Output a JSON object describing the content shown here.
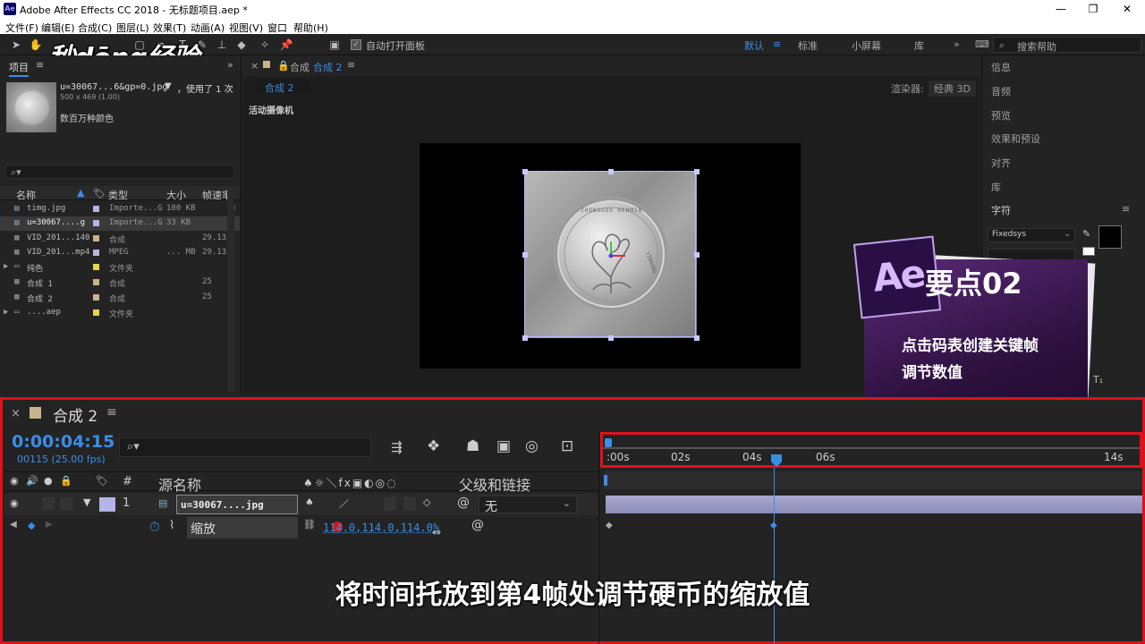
{
  "window": {
    "title": "Adobe After Effects CC 2018 - 无标题项目.aep *",
    "logo": "Ae",
    "controls": [
      "minimize-icon",
      "maximize-icon",
      "close-icon"
    ]
  },
  "menu": [
    "文件(F)",
    "编辑(E)",
    "合成(C)",
    "图层(L)",
    "效果(T)",
    "动画(A)",
    "视图(V)",
    "窗口",
    "帮助(H)"
  ],
  "toolbar": {
    "auto_open_label": "自动打开面板",
    "workspaces": [
      "默认",
      "标准",
      "小屏幕",
      "库"
    ],
    "search_placeholder": "搜索帮助"
  },
  "watermark": "秒dōng经验",
  "project": {
    "tab_label": "项目",
    "selected_file": "u=30067...6&gp=0.jpg",
    "usage": "，使用了 1 次",
    "dims": "500 x 469 (1.00)",
    "color_info": "数百万种颜色",
    "columns": [
      "名称",
      "类型",
      "大小",
      "帧速率"
    ],
    "rows": [
      {
        "name": "timg.jpg",
        "type": "Importe...G",
        "size": "100 KB",
        "fps": "",
        "color": "#b4b4e6"
      },
      {
        "name": "u=30067....g",
        "type": "Importe...G",
        "size": "33 KB",
        "fps": "",
        "color": "#b4b4e6"
      },
      {
        "name": "VID_201...140",
        "type": "合成",
        "size": "",
        "fps": "29.135",
        "color": "#c8b48c"
      },
      {
        "name": "VID_201...mp4",
        "type": "MPEG",
        "size": "... MB",
        "fps": "29.135",
        "color": "#b4b4e6"
      },
      {
        "name": "纯色",
        "type": "文件夹",
        "size": "",
        "fps": "",
        "color": "#e6d24b"
      },
      {
        "name": "合成 1",
        "type": "合成",
        "size": "",
        "fps": "25",
        "color": "#c8b48c"
      },
      {
        "name": "合成 2",
        "type": "合成",
        "size": "",
        "fps": "25",
        "color": "#c8b48c"
      },
      {
        "name": "....aep",
        "type": "文件夹",
        "size": "",
        "fps": "",
        "color": "#e6d24b"
      }
    ]
  },
  "viewer": {
    "tab_prefix": "合成",
    "tab_name": "合成 2",
    "sub_tab": "合成 2",
    "renderer_label": "渲染器:",
    "renderer_value": "经典 3D",
    "camera_label": "活动摄像机"
  },
  "coin": {
    "inscription_top": "ZHONGGUO RENMIN",
    "inscription_right": "YINHANG"
  },
  "right_panel": {
    "items": [
      "信息",
      "音频",
      "预览",
      "效果和预设",
      "对齐",
      "库",
      "字符"
    ],
    "font_name": "Fixedsys"
  },
  "tip": {
    "logo": "Ae",
    "title": "要点02",
    "line1": "点击码表创建关键帧",
    "line2": "调节数值"
  },
  "timeline": {
    "comp_name": "合成 2",
    "timecode": "0:00:04:15",
    "frame_info": "00115 (25.00 fps)",
    "col_num": "#",
    "col_source": "源名称",
    "col_parent": "父级和链接",
    "ruler_labels": [
      ":00s",
      "02s",
      "04s",
      "06s",
      "14s"
    ],
    "layer": {
      "index": "1",
      "name": "u=30067....jpg",
      "parent": "无"
    },
    "property": {
      "name": "缩放",
      "value": "114.0,114.0,114.0%"
    }
  },
  "subtitle": "将时间托放到第4帧处调节硬币的缩放值",
  "colors": {
    "accent": "#3a8ee6",
    "highlight_red": "#e0101a",
    "tip_purple": "#3a1850"
  }
}
